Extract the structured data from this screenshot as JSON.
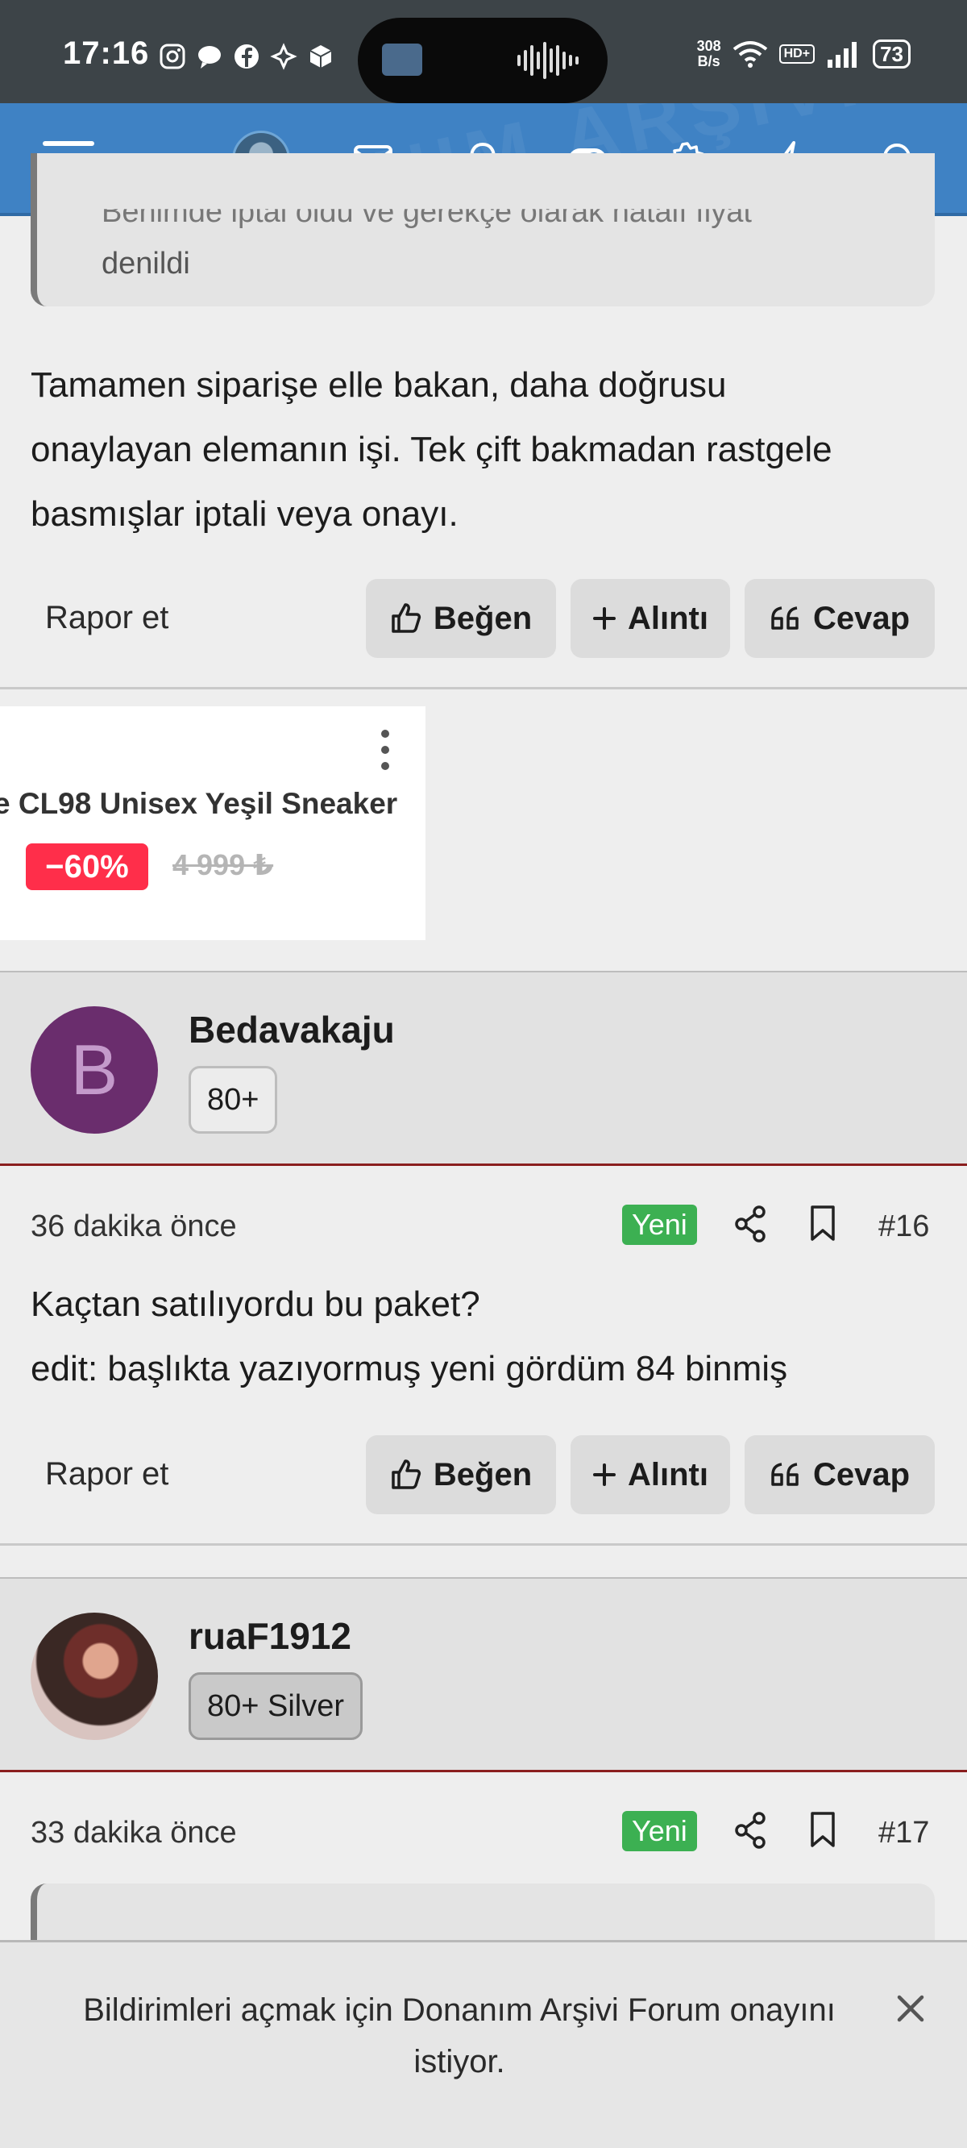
{
  "status_bar": {
    "time": "17:16",
    "net_speed_value": "308",
    "net_speed_unit": "B/s",
    "hd_label": "HD+",
    "battery": "73"
  },
  "navbar": {
    "watermark": "DONANIM ARŞİVİ",
    "icons": [
      "menu-icon",
      "avatar",
      "mail-icon",
      "bell-icon",
      "toggle-icon",
      "gear-icon",
      "bolt-icon",
      "search-icon"
    ]
  },
  "post_prev": {
    "quote_cut": "Benimde iptal oldu ve gerekçe olarak hatalı fiyat",
    "quote_tail": "denildi",
    "lines": [
      "Tamamen siparişe elle bakan, daha doğrusu",
      "onaylayan elemanın işi. Tek çift bakmadan rastgele",
      "basmışlar iptali veya onayı."
    ],
    "report": "Rapor et",
    "like": "Beğen",
    "quote": "Alıntı",
    "reply": "Cevap"
  },
  "ad": {
    "title": "e CL98 Unisex Yeşil Sneaker",
    "discount": "−60%",
    "old_price": "4 999 ₺"
  },
  "post16": {
    "user": "Bedavakaju",
    "avatar_letter": "B",
    "badge": "80+",
    "time": "36 dakika önce",
    "new_label": "Yeni",
    "number": "#16",
    "lines": [
      "Kaçtan satılıyordu bu paket?",
      "edit: başlıkta yazıyormuş yeni gördüm 84 binmiş"
    ],
    "report": "Rapor et",
    "like": "Beğen",
    "quote": "Alıntı",
    "reply": "Cevap"
  },
  "post17": {
    "user": "ruaF1912",
    "badge": "80+ Silver",
    "time": "33 dakika önce",
    "new_label": "Yeni",
    "number": "#17"
  },
  "notification": {
    "text": "Bildirimleri açmak için Donanım Arşivi Forum onayını istiyor."
  },
  "colors": {
    "navbar": "#3f82c4",
    "new_badge": "#3cb052",
    "discount": "#ff2e4a",
    "avatar_b": "#6a2d6d",
    "user_divider": "#8a1e1e"
  }
}
